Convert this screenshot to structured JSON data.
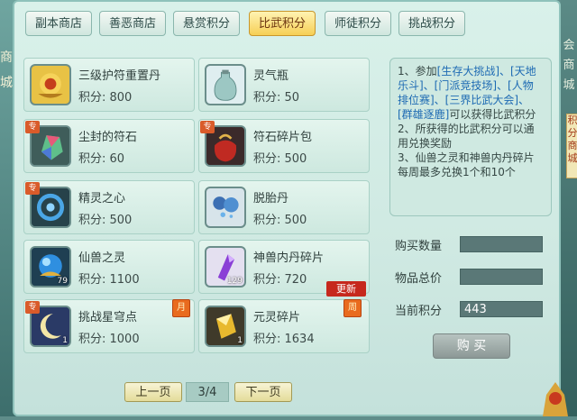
{
  "side": {
    "left_text": "商城",
    "right_text": "会商城",
    "right_tag": "积分商城"
  },
  "tabs": [
    {
      "label": "副本商店",
      "active": false
    },
    {
      "label": "善恶商店",
      "active": false
    },
    {
      "label": "悬赏积分",
      "active": false
    },
    {
      "label": "比武积分",
      "active": true
    },
    {
      "label": "师徒积分",
      "active": false
    },
    {
      "label": "挑战积分",
      "active": false
    }
  ],
  "items": [
    {
      "name": "三级护符重置丹",
      "price": "积分: 800",
      "icon": "gold-flower-icon"
    },
    {
      "name": "灵气瓶",
      "price": "积分: 50",
      "icon": "spirit-bottle-icon"
    },
    {
      "name": "尘封的符石",
      "price": "积分: 60",
      "icon": "rune-stone-icon",
      "special": "专"
    },
    {
      "name": "符石碎片包",
      "price": "积分: 500",
      "icon": "rune-bag-icon",
      "special": "专"
    },
    {
      "name": "精灵之心",
      "price": "积分: 500",
      "icon": "spirit-heart-icon",
      "special": "专"
    },
    {
      "name": "脱胎丹",
      "price": "积分: 500",
      "icon": "rebirth-pill-icon"
    },
    {
      "name": "仙兽之灵",
      "price": "积分: 1100",
      "icon": "blue-orb-icon",
      "count": "79"
    },
    {
      "name": "神兽内丹碎片",
      "price": "积分: 720",
      "icon": "purple-crystal-icon",
      "count": "129"
    },
    {
      "name": "挑战星穹点",
      "price": "积分: 1000",
      "icon": "moon-icon",
      "special": "专",
      "count": "1",
      "badge": "月"
    },
    {
      "name": "元灵碎片",
      "price": "积分: 1634",
      "icon": "gold-shard-icon",
      "count": "1",
      "badge": "周"
    }
  ],
  "new_badge": "更新",
  "info": {
    "p1_prefix": "1、参加",
    "p1_links": "[生存大挑战]、[天地乐斗]、[门派竞技场]、[人物排位赛]、[三界比武大会]、[群雄逐鹿]",
    "p1_suffix": "可以获得比武积分",
    "p2": "2、所获得的比武积分可以通用兑换奖励",
    "p3": "3、仙兽之灵和神兽内丹碎片每周最多兑换1个和10个"
  },
  "form": {
    "quantity_label": "购买数量",
    "quantity_value": "",
    "total_label": "物品总价",
    "total_value": "",
    "points_label": "当前积分",
    "points_value": "443"
  },
  "buy_label": "购 买",
  "pager": {
    "prev": "上一页",
    "indicator": "3/4",
    "next": "下一页"
  },
  "colors": {
    "active_tab": "#f6cf55",
    "link": "#1d6ab3",
    "new_badge": "#c6281d"
  }
}
